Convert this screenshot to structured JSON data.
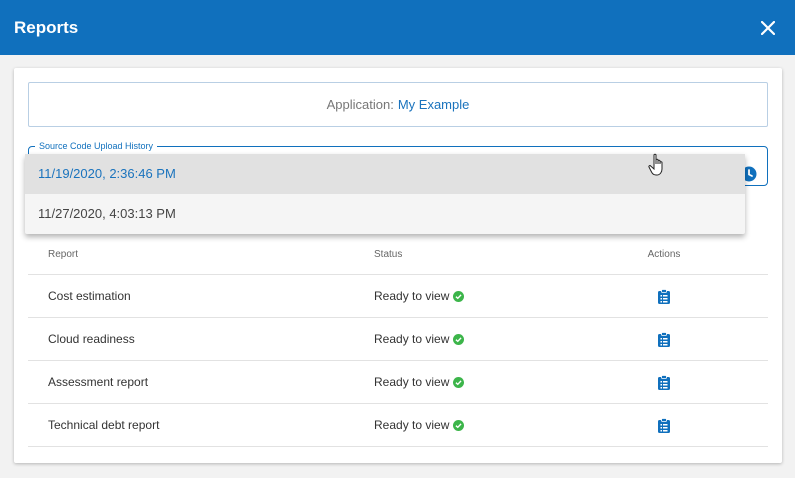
{
  "dialog": {
    "title": "Reports"
  },
  "application": {
    "label": "Application:",
    "value": "My Example"
  },
  "upload_history": {
    "legend": "Source Code Upload History",
    "options": [
      "11/19/2020, 2:36:46 PM",
      "11/27/2020, 4:03:13 PM"
    ],
    "selected_index": 0
  },
  "table": {
    "headers": {
      "report": "Report",
      "status": "Status",
      "actions": "Actions"
    },
    "rows": [
      {
        "report": "Cost estimation",
        "status": "Ready to view"
      },
      {
        "report": "Cloud readiness",
        "status": "Ready to view"
      },
      {
        "report": "Assessment report",
        "status": "Ready to view"
      },
      {
        "report": "Technical debt report",
        "status": "Ready to view"
      }
    ]
  },
  "colors": {
    "header_bg": "#1070bd",
    "accent": "#1a73bd",
    "status_ok": "#3cb54a"
  }
}
